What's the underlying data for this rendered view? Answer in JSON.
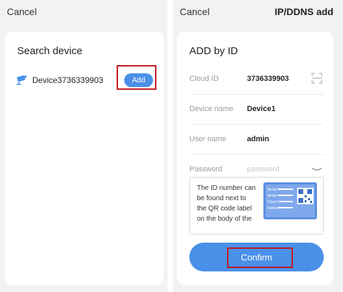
{
  "left": {
    "cancel_label": "Cancel",
    "card_title": "Search device",
    "device": {
      "name": "Device3736339903",
      "add_label": "Add"
    }
  },
  "right": {
    "cancel_label": "Cancel",
    "header_action": "IP/DDNS add",
    "card_title": "ADD by ID",
    "fields": {
      "cloud_id_label": "Cloud ID",
      "cloud_id_value": "3736339903",
      "device_name_label": "Device name",
      "device_name_value": "Device1",
      "user_name_label": "User name",
      "user_name_value": "admin",
      "password_label": "Password",
      "password_placeholder": "password"
    },
    "hint_text": "The ID number can be found next to the QR code label on the body of the",
    "qr_labels": [
      "Model",
      "Model",
      "Cloud ID",
      "Reboot"
    ],
    "confirm_label": "Confirm"
  },
  "colors": {
    "accent": "#4a90e8",
    "highlight": "#c3161c",
    "background": "#f2f2f4",
    "card": "#ffffff"
  }
}
